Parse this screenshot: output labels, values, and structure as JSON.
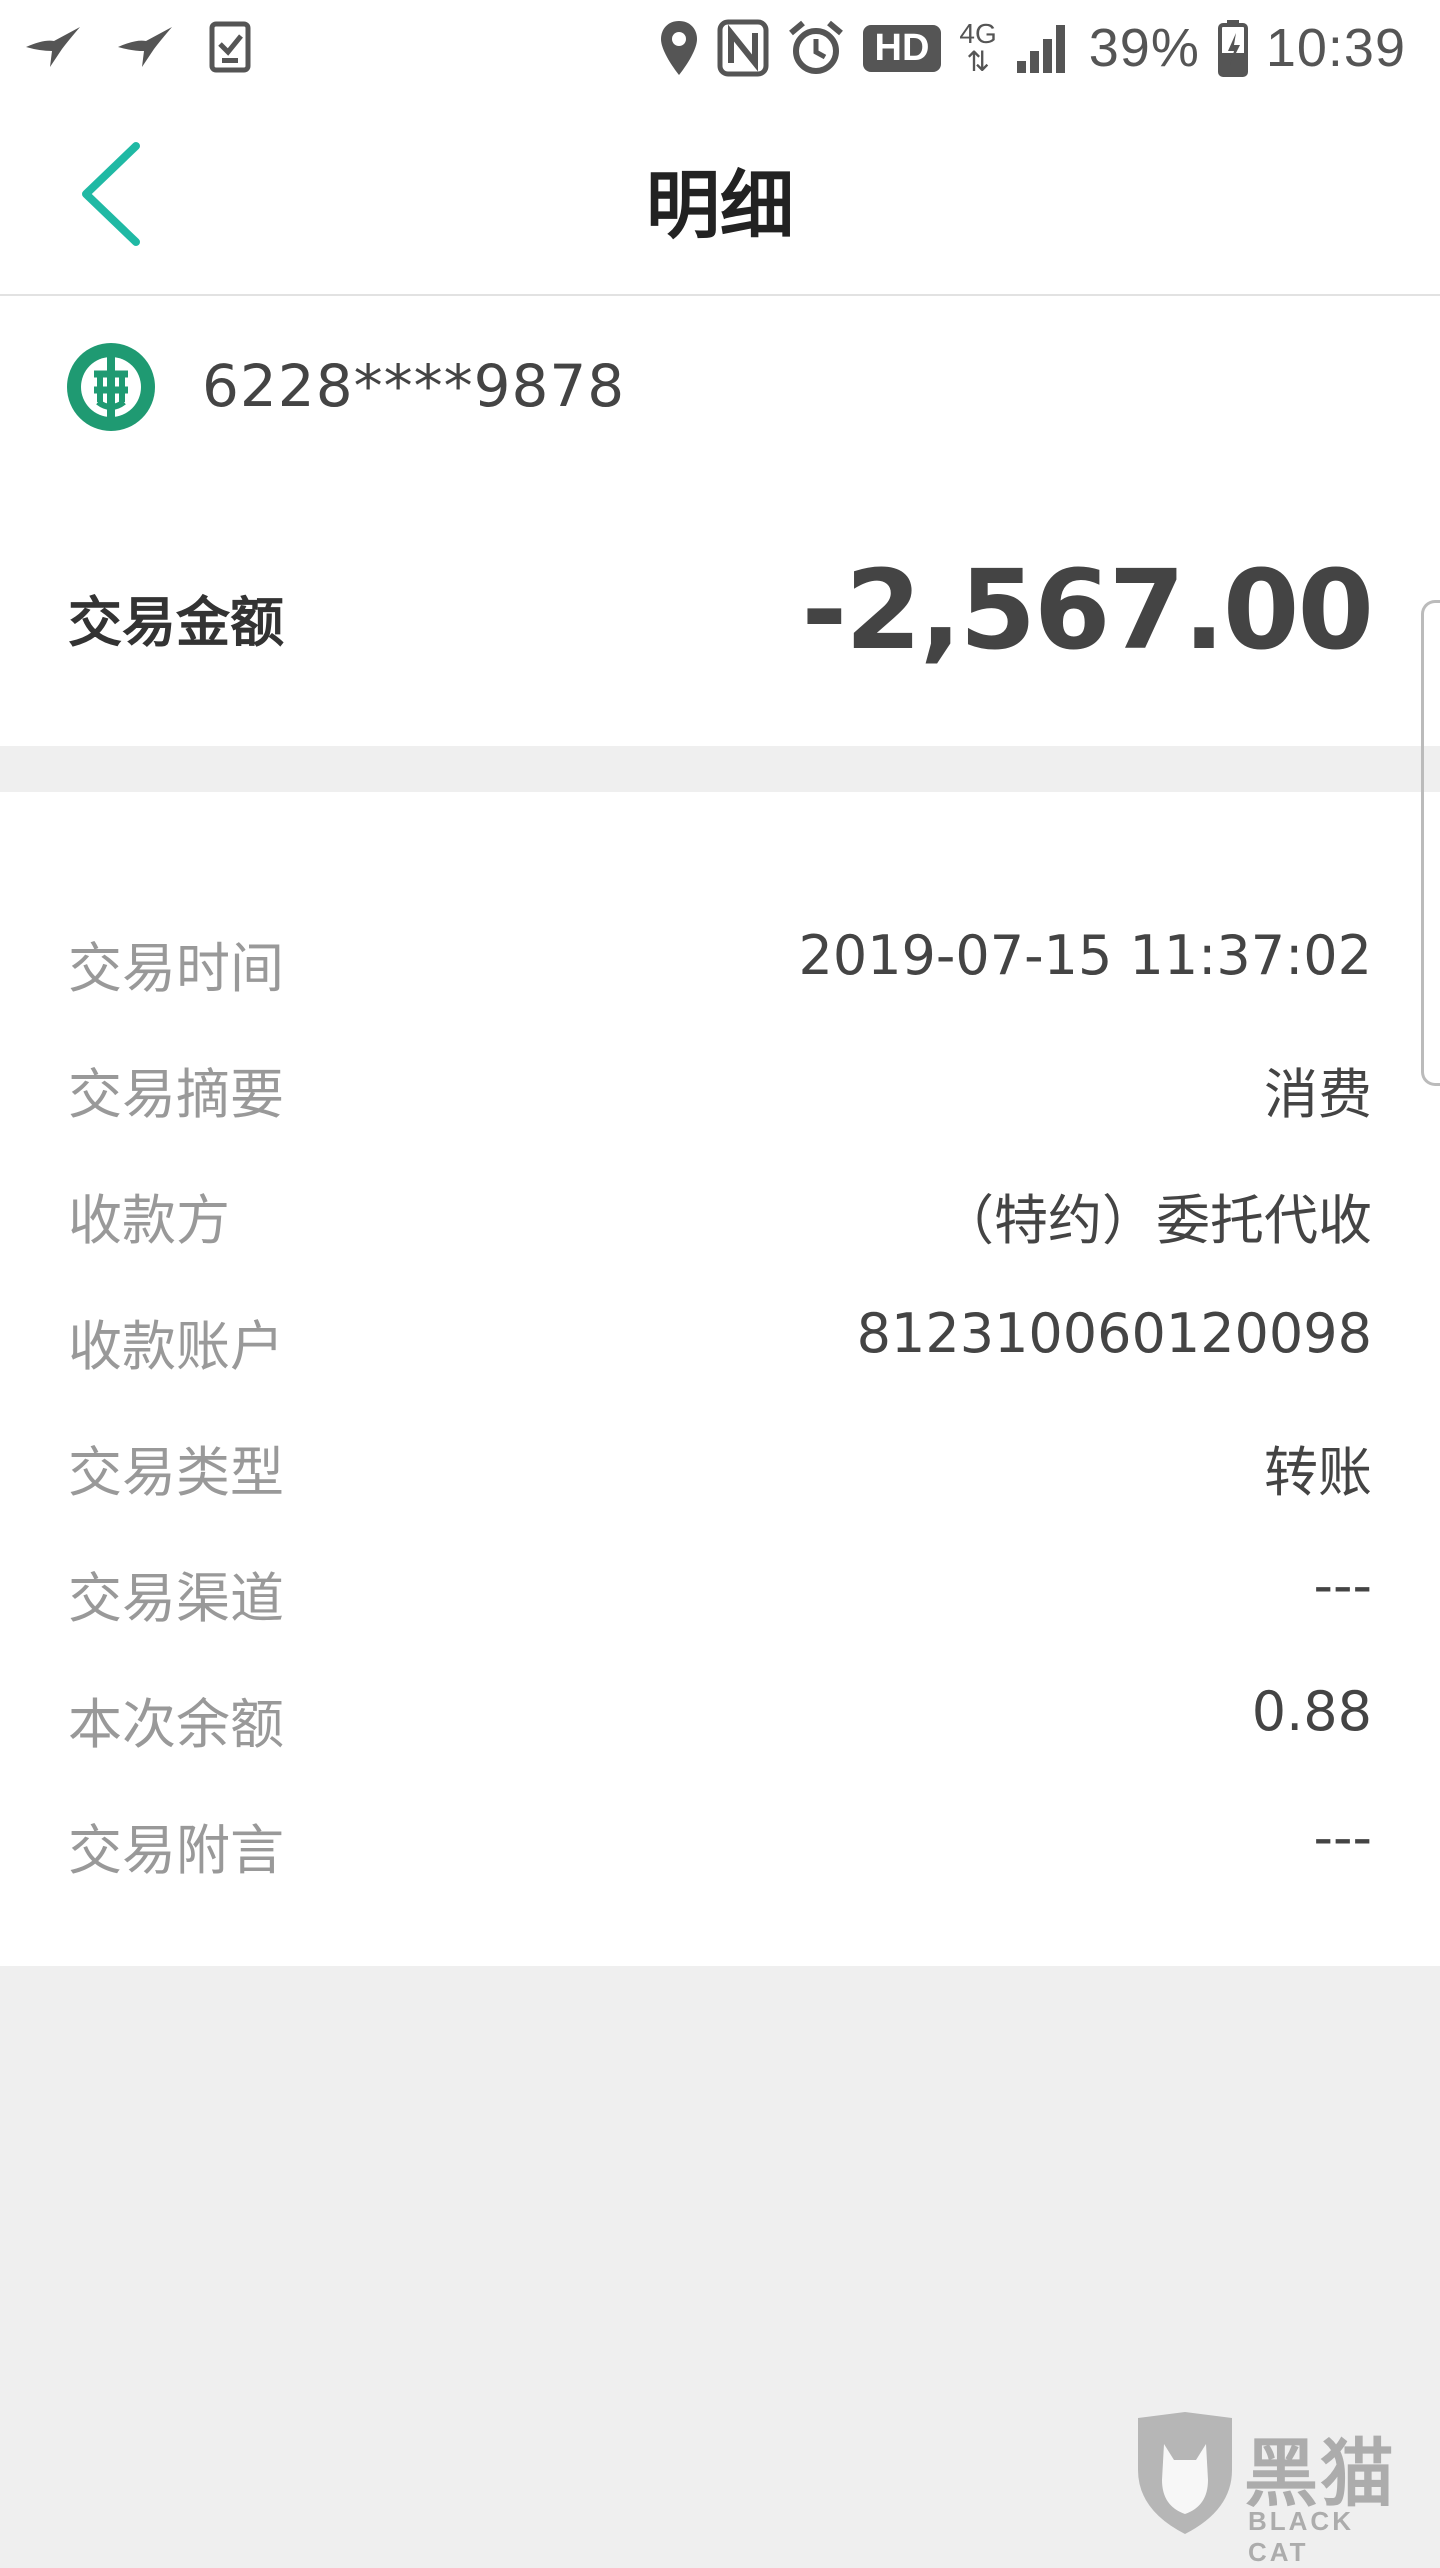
{
  "status_bar": {
    "network_type": "4G",
    "hd_label": "HD",
    "battery": "39%",
    "time": "10:39"
  },
  "header": {
    "title": "明细"
  },
  "account": {
    "number": "6228****9878"
  },
  "amount": {
    "label": "交易金额",
    "value": "-2,567.00"
  },
  "details": [
    {
      "label": "交易时间",
      "value": "2019-07-15 11:37:02"
    },
    {
      "label": "交易摘要",
      "value": "消费"
    },
    {
      "label": "收款方",
      "value": "（特约）委托代收"
    },
    {
      "label": "收款账户",
      "value": "812310060120098"
    },
    {
      "label": "交易类型",
      "value": "转账"
    },
    {
      "label": "交易渠道",
      "value": "---"
    },
    {
      "label": "本次余额",
      "value": "0.88"
    },
    {
      "label": "交易附言",
      "value": "---"
    }
  ],
  "watermark": {
    "text": "黑猫",
    "sub": "BLACK CAT"
  },
  "colors": {
    "accent": "#20b9a4",
    "bank_green": "#1f9a72"
  }
}
